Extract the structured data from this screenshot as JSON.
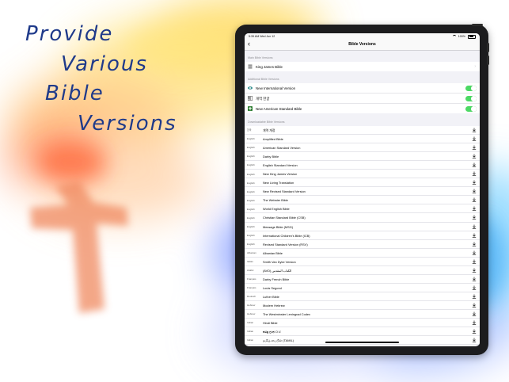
{
  "tagline": [
    "Provide",
    "Various",
    "Bible",
    "Versions"
  ],
  "status": {
    "time": "5:39 AM",
    "date": "Wed Jun 12",
    "battery": "100%"
  },
  "nav": {
    "back": "‹",
    "title": "Bible Versions"
  },
  "main_section": {
    "header": "Main Bible Versions",
    "item": "King James Bible"
  },
  "additional_section": {
    "header": "Additional Bible Versions",
    "items": [
      "New International Version",
      "개역 한글",
      "New American Standard Bible"
    ]
  },
  "downloadable_section": {
    "header": "Downloadable Bible Versions",
    "items": [
      {
        "lang": "한국",
        "name": "개역 개정"
      },
      {
        "lang": "English",
        "name": "Amplified Bible"
      },
      {
        "lang": "English",
        "name": "American Standard Version"
      },
      {
        "lang": "English",
        "name": "Darby Bible"
      },
      {
        "lang": "English",
        "name": "English Standard Version"
      },
      {
        "lang": "English",
        "name": "New King James Version"
      },
      {
        "lang": "English",
        "name": "New Living Translation"
      },
      {
        "lang": "English",
        "name": "New Revised Standard Version"
      },
      {
        "lang": "English",
        "name": "The Webster Bible"
      },
      {
        "lang": "English",
        "name": "World English Bible"
      },
      {
        "lang": "English",
        "name": "Christian Standard Bible (CSB)"
      },
      {
        "lang": "English",
        "name": "Message Bible (MSG)"
      },
      {
        "lang": "English",
        "name": "International Children's Bible (ICB)"
      },
      {
        "lang": "English",
        "name": "Revised Standard Version (RSV)"
      },
      {
        "lang": "Albanian",
        "name": "Albanian Bible"
      },
      {
        "lang": "Italian",
        "name": "Smith Van Dyke Version"
      },
      {
        "lang": "Arabic",
        "name": "(AVD) الكتاب المقدس"
      },
      {
        "lang": "Français",
        "name": "Darby French Bible"
      },
      {
        "lang": "Français",
        "name": "Louis Segond"
      },
      {
        "lang": "Deutsch",
        "name": "Luther Bible"
      },
      {
        "lang": "Hebrew",
        "name": "Modern Hebrew"
      },
      {
        "lang": "Hebrew",
        "name": "The Westminster Leningrad Codex"
      },
      {
        "lang": "Indian",
        "name": "Hindi Bible"
      },
      {
        "lang": "Indian",
        "name": "ಪವಿತ್ರ ಗ್ರಂಥ O.V."
      },
      {
        "lang": "Indian",
        "name": "தமிழ் பைபிள் (TAMIL)"
      }
    ]
  },
  "colors": {
    "toggle_on": "#4cd964",
    "tagline": "#1f3a8a",
    "accent": "#34c759"
  },
  "icons": {
    "main_row": "book-stack-icon",
    "additional": [
      "niv-logo-icon",
      "cross-book-icon",
      "nasb-cross-icon"
    ],
    "download": "download-icon"
  }
}
